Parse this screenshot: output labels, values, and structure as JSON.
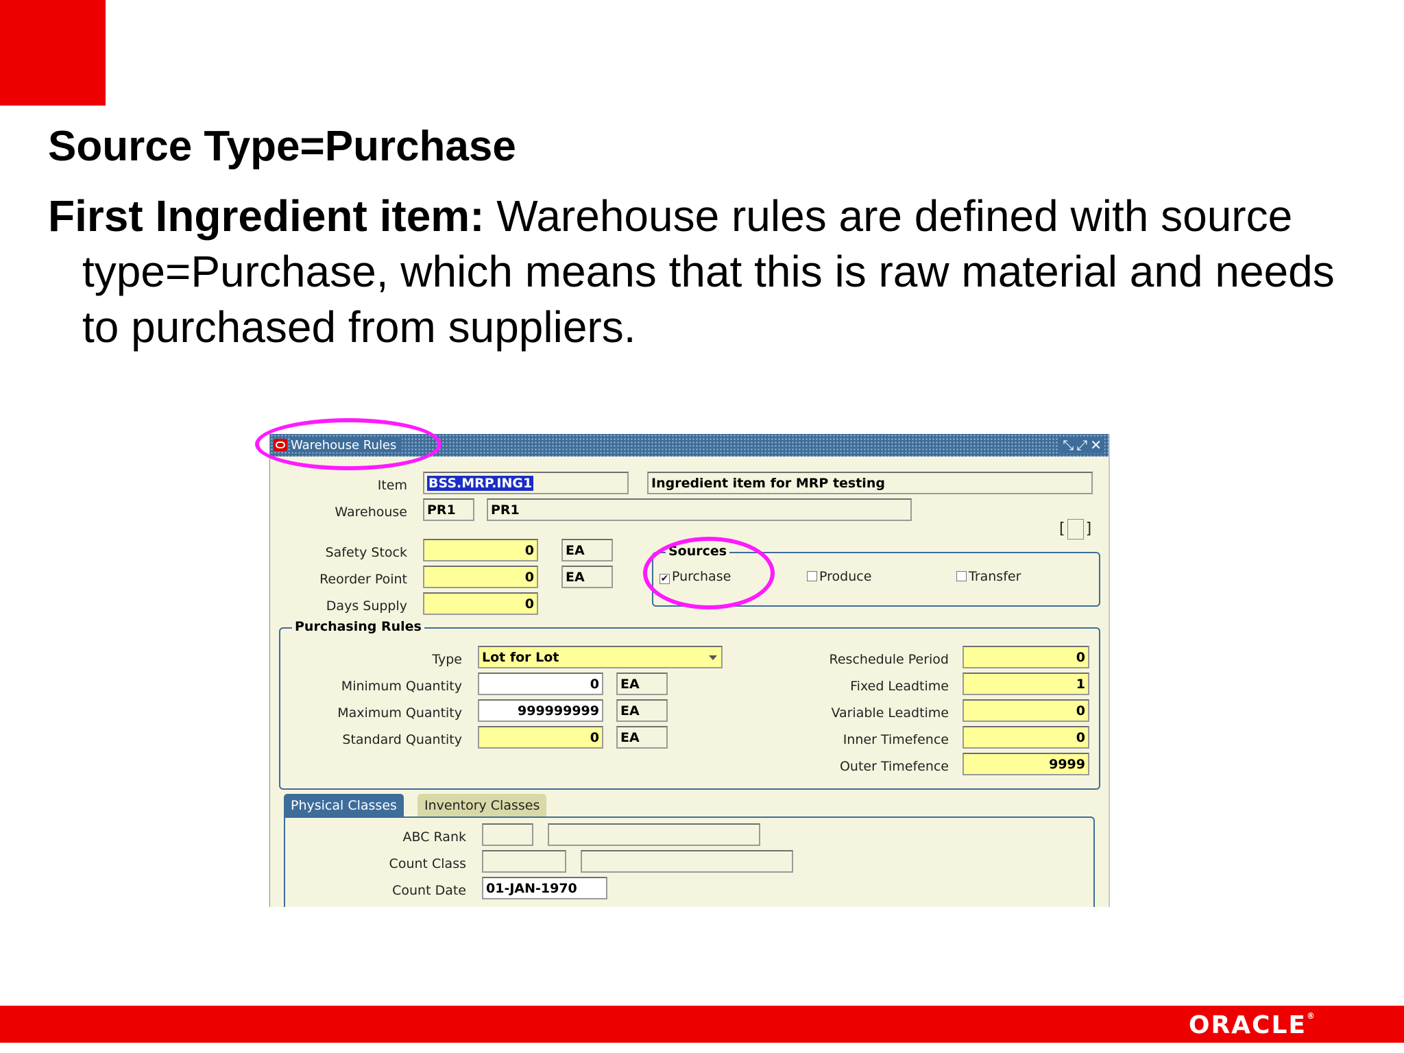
{
  "slide": {
    "heading": "Source Type=Purchase",
    "body_bold": "First Ingredient item:",
    "body_text": " Warehouse rules are defined with source type=Purchase, which means that this is raw material and needs to purchased from suppliers.",
    "logo": "ORACLE",
    "logo_tm": "®"
  },
  "window": {
    "title": "Warehouse Rules",
    "controls": "⤡⤢✕",
    "item_label": "Item",
    "item_value": "BSS.MRP.ING1",
    "item_description": "Ingredient item for MRP testing",
    "warehouse_label": "Warehouse",
    "warehouse_code": "PR1",
    "warehouse_name": "PR1",
    "safety_stock_label": "Safety Stock",
    "safety_stock_value": "0",
    "safety_stock_uom": "EA",
    "reorder_point_label": "Reorder Point",
    "reorder_point_value": "0",
    "reorder_point_uom": "EA",
    "days_supply_label": "Days Supply",
    "days_supply_value": "0",
    "sources": {
      "title": "Sources",
      "purchase_label": "Purchase",
      "purchase_checked": true,
      "produce_label": "Produce",
      "produce_checked": false,
      "transfer_label": "Transfer",
      "transfer_checked": false
    },
    "purchasing_rules": {
      "title": "Purchasing Rules",
      "type_label": "Type",
      "type_value": "Lot for Lot",
      "min_qty_label": "Minimum Quantity",
      "min_qty_value": "0",
      "min_qty_uom": "EA",
      "max_qty_label": "Maximum Quantity",
      "max_qty_value": "999999999",
      "max_qty_uom": "EA",
      "std_qty_label": "Standard Quantity",
      "std_qty_value": "0",
      "std_qty_uom": "EA",
      "reschedule_label": "Reschedule Period",
      "reschedule_value": "0",
      "fixed_lt_label": "Fixed Leadtime",
      "fixed_lt_value": "1",
      "variable_lt_label": "Variable Leadtime",
      "variable_lt_value": "0",
      "inner_tf_label": "Inner Timefence",
      "inner_tf_value": "0",
      "outer_tf_label": "Outer Timefence",
      "outer_tf_value": "9999"
    },
    "tabs": {
      "physical": "Physical Classes",
      "inventory": "Inventory Classes"
    },
    "abc_rank_label": "ABC Rank",
    "count_class_label": "Count Class",
    "count_date_label": "Count Date",
    "count_date_value": "01-JAN-1970"
  }
}
